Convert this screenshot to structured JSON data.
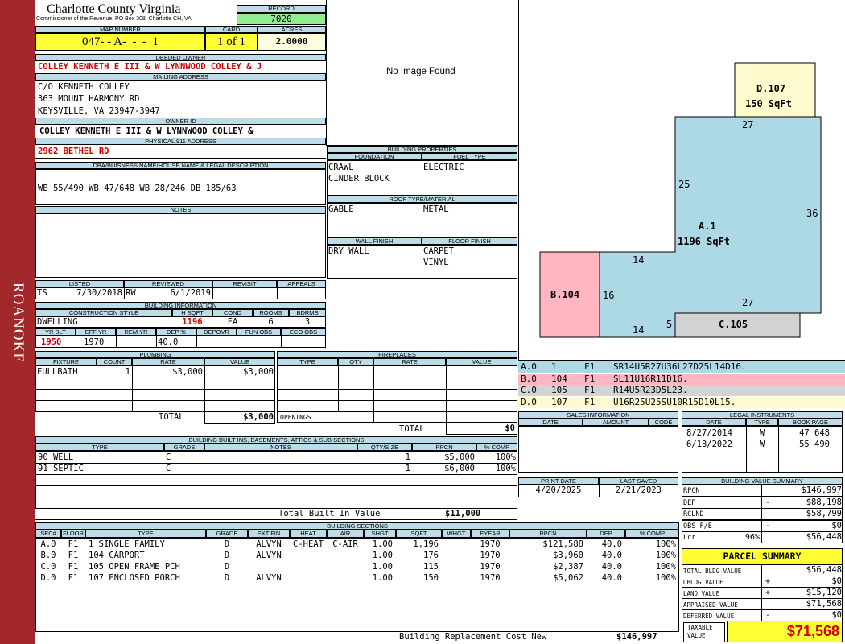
{
  "side_label": "ROANOKE",
  "header": {
    "county": "Charlotte County Virginia",
    "commissioner": "Commissioner of the Revenue, PO Box 308, Charlotte CH, VA",
    "record_label": "RECORD",
    "record": "7020",
    "map_label": "MAP NUMBER",
    "map_number": "047- - A-  -  -  1",
    "card_label": "CARD",
    "card": "1 of 1",
    "acres_label": "ACRES",
    "acres": "2.0000"
  },
  "deeded_owner_label": "DEEDED OWNER",
  "deeded_owner": "COLLEY KENNETH E III & W LYNNWOOD COLLEY & J",
  "mailing_label": "MAILING ADDRESS",
  "mailing": [
    "C/O KENNETH COLLEY",
    "363 MOUNT HARMONY RD",
    "KEYSVILLE, VA 23947-3947"
  ],
  "owner_id_label": "OWNER ID",
  "owner_id": "COLLEY KENNETH E III & W LYNNWOOD COLLEY &",
  "physical_label": "PHYSICAL 911 ADDRESS",
  "physical": "2962 BETHEL RD",
  "dba_label": "DBA/BUISNESS NAME/HOUSE NAME & LEGAL DESCRIPTION",
  "dba": "WB 55/490 WB 47/648 WB 28/246 DB 185/63",
  "notes_label": "NOTES",
  "image": {
    "text": "No Image Found"
  },
  "building_props": {
    "title": "BUILDING PROPERTIES",
    "foundation_label": "FOUNDATION",
    "foundation": [
      "CRAWL",
      "CINDER BLOCK"
    ],
    "fuel_label": "FUEL TYPE",
    "fuel": "ELECTRIC",
    "roof_label": "ROOF TYPE/MATERIAL",
    "roof_type": "GABLE",
    "roof_material": "METAL",
    "wall_label": "WALL FINISH",
    "wall": "DRY WALL",
    "floor_label": "FLOOR FINISH",
    "floor": [
      "CARPET",
      "VINYL"
    ]
  },
  "listed": {
    "listed_label": "LISTED",
    "listed_by": "TS",
    "listed_date": "7/30/2018",
    "reviewed_label": "REVIEWED",
    "reviewed_by": "RW",
    "reviewed_date": "6/1/2019",
    "revisit_label": "REVISIT",
    "appeals_label": "APPEALS"
  },
  "building_info": {
    "title": "BUILDING INFORMATION",
    "style_label": "CONSTRUCTION STYLE",
    "style": "DWELLING",
    "hsqft_label": "H SQFT",
    "hsqft": "1196",
    "cond_label": "COND",
    "cond": "FA",
    "rooms_label": "ROOMS",
    "rooms": "6",
    "bdrms_label": "BDRMS",
    "bdrms": "3",
    "yrblt_label": "YR BLT",
    "yrblt": "1950",
    "effyr_label": "EFF YR",
    "effyr": "1970",
    "remyr_label": "REM YR",
    "dep_label": "DEP %",
    "dep": "40.0",
    "depovr_label": "DEPOVR",
    "funobs_label": "FUN OBS",
    "ecoobs_label": "ECO OBS"
  },
  "plumbing": {
    "title": "PLUMBING",
    "cols": [
      "FIXTURE",
      "COUNT",
      "RATE",
      "VALUE"
    ],
    "rows": [
      [
        "FULLBATH",
        "1",
        "$3,000",
        "$3,000"
      ]
    ],
    "total_label": "TOTAL",
    "total": "$3,000"
  },
  "fireplaces": {
    "title": "FIREPLACES",
    "cols": [
      "TYPE",
      "QTY",
      "RATE",
      "VALUE"
    ],
    "openings_label": "OPENINGS",
    "total_label": "TOTAL",
    "total": "$0"
  },
  "built_ins": {
    "title": "BUILDING BUILT INS, BASEMENTS, ATTICS & SUB SECTIONS",
    "cols": [
      "TYPE",
      "GRADE",
      "NOTES",
      "QTY/SIZE",
      "RPCN",
      "% COMP"
    ],
    "rows": [
      [
        "90 WELL",
        "C",
        "",
        "1",
        "$5,000",
        "100%"
      ],
      [
        "91 SEPTIC",
        "C",
        "",
        "1",
        "$6,000",
        "100%"
      ]
    ],
    "total_label": "Total Built In Value",
    "total": "$11,000"
  },
  "sections": {
    "title": "BUILDING SECTIONS",
    "cols": [
      "SEC#",
      "FLOOR",
      "TYPE",
      "GRADE",
      "EXT FIN",
      "HEAT",
      "AIR",
      "SHGT",
      "SQFT",
      "WHGT",
      "EYEAR",
      "RPCN",
      "DEP",
      "% COMP"
    ],
    "rows": [
      [
        "A.0",
        "F1",
        "1 SINGLE FAMILY",
        "D",
        "ALVYN",
        "C-HEAT",
        "C-AIR",
        "1.00",
        "1,196",
        "",
        "1970",
        "$121,588",
        "40.0",
        "100%"
      ],
      [
        "B.0",
        "F1",
        "104 CARPORT",
        "D",
        "ALVYN",
        "",
        "",
        "1.00",
        "176",
        "",
        "1970",
        "$3,960",
        "40.0",
        "100%"
      ],
      [
        "C.0",
        "F1",
        "105 OPEN FRAME PCH",
        "D",
        "",
        "",
        "",
        "1.00",
        "115",
        "",
        "1970",
        "$2,387",
        "40.0",
        "100%"
      ],
      [
        "D.0",
        "F1",
        "107 ENCLOSED PORCH",
        "D",
        "ALVYN",
        "",
        "",
        "1.00",
        "150",
        "",
        "1970",
        "$5,062",
        "40.0",
        "100%"
      ]
    ],
    "brcn_label": "Building Replacement Cost New",
    "brcn": "$146,997"
  },
  "sketch": {
    "A": {
      "label": "A.1",
      "sqft": "1196 SqFt",
      "dims": [
        "27",
        "25",
        "36",
        "14",
        "27",
        "16",
        "14",
        "5"
      ]
    },
    "B": {
      "label": "B.104"
    },
    "C": {
      "label": "C.105"
    },
    "D": {
      "label": "D.107",
      "sqft": "150 SqFt"
    },
    "colors": {
      "A": "#add8e6",
      "B": "#ffb6c1",
      "C": "#d3d3d3",
      "D": "#fffacd"
    }
  },
  "vectors": [
    {
      "sec": "A.0",
      "n": "1",
      "fl": "F1",
      "v": "SR14U5R27U36L27D25L14D16.",
      "color": "#add8e6"
    },
    {
      "sec": "B.0",
      "n": "104",
      "fl": "F1",
      "v": "SL11U16R11D16.",
      "color": "#ffb6c1"
    },
    {
      "sec": "C.0",
      "n": "105",
      "fl": "F1",
      "v": "R14U5R23D5L23.",
      "color": "#d3d3d3"
    },
    {
      "sec": "D.0",
      "n": "107",
      "fl": "F1",
      "v": "U16R25U25SU10R15D10L15.",
      "color": "#fffacd"
    }
  ],
  "sales": {
    "title": "SALES INFORMATION",
    "cols": [
      "DATE",
      "AMOUNT",
      "CODE"
    ]
  },
  "legal": {
    "title": "LEGAL INSTRUMENTS",
    "cols": [
      "DATE",
      "TYPE",
      "BOOK PAGE"
    ],
    "rows": [
      [
        "8/27/2014",
        "W",
        "47 648"
      ],
      [
        "6/13/2022",
        "W",
        "55 490"
      ]
    ]
  },
  "print": {
    "print_label": "PRINT DATE",
    "print_date": "4/20/2025",
    "saved_label": "LAST SAVED",
    "saved_date": "2/21/2023"
  },
  "value_summary": {
    "title": "BUILDING VALUE SUMMARY",
    "rows": [
      {
        "label": "RPCN",
        "sign": "",
        "value": "$146,997"
      },
      {
        "label": "DEP",
        "sign": "-",
        "value": "$88,198"
      },
      {
        "label": "RCLND",
        "sign": "",
        "value": "$58,799"
      },
      {
        "label": "OBS F/E",
        "sign": "-",
        "value": "$0"
      },
      {
        "label": "Lcr",
        "pct": "96%",
        "sign": "",
        "value": "$56,448"
      }
    ]
  },
  "parcel": {
    "title": "PARCEL SUMMARY",
    "rows": [
      {
        "label": "TOTAL BLDG VALUE",
        "sign": "",
        "value": "$56,448"
      },
      {
        "label": "OBLDG VALUE",
        "sign": "+",
        "value": "$0"
      },
      {
        "label": "LAND VALUE",
        "sign": "+",
        "value": "$15,120"
      },
      {
        "label": "APPRAISED VALUE",
        "sign": "",
        "value": "$71,568"
      },
      {
        "label": "DEFERRED VALUE",
        "sign": "-",
        "value": "$0"
      }
    ],
    "taxable_label": "TAXABLE VALUE",
    "taxable": "$71,568"
  }
}
